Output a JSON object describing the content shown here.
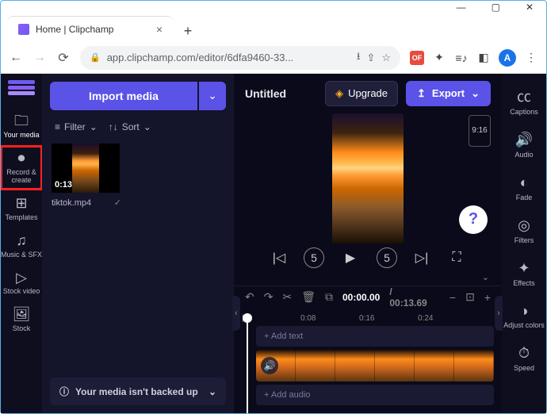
{
  "browser": {
    "tab_title": "Home | Clipchamp",
    "url": "app.clipchamp.com/editor/6dfa9460-33...",
    "avatar_letter": "A",
    "ext_label": "OF"
  },
  "leftnav": {
    "your_media": "Your media",
    "record_create": "Record & create",
    "templates": "Templates",
    "music_sfx": "Music & SFX",
    "stock_video": "Stock video",
    "stock": "Stock"
  },
  "media": {
    "import_label": "Import media",
    "filter_label": "Filter",
    "sort_label": "Sort",
    "clip_duration": "0:13",
    "clip_name": "tiktok.mp4",
    "backup_msg": "Your media isn't backed up"
  },
  "topbar": {
    "project_name": "Untitled",
    "upgrade_label": "Upgrade",
    "export_label": "Export"
  },
  "canvas": {
    "aspect_label": "9:16"
  },
  "timeline": {
    "current": "00:00.00",
    "duration": "00:13.69",
    "marks": {
      "m0": "|",
      "m1": "0:08",
      "m2": "0:16",
      "m3": "0:24"
    },
    "add_text": "+  Add text",
    "add_audio": "+  Add audio"
  },
  "rightnav": {
    "captions": "Captions",
    "audio": "Audio",
    "fade": "Fade",
    "filters": "Filters",
    "effects": "Effects",
    "adjust": "Adjust colors",
    "speed": "Speed"
  }
}
